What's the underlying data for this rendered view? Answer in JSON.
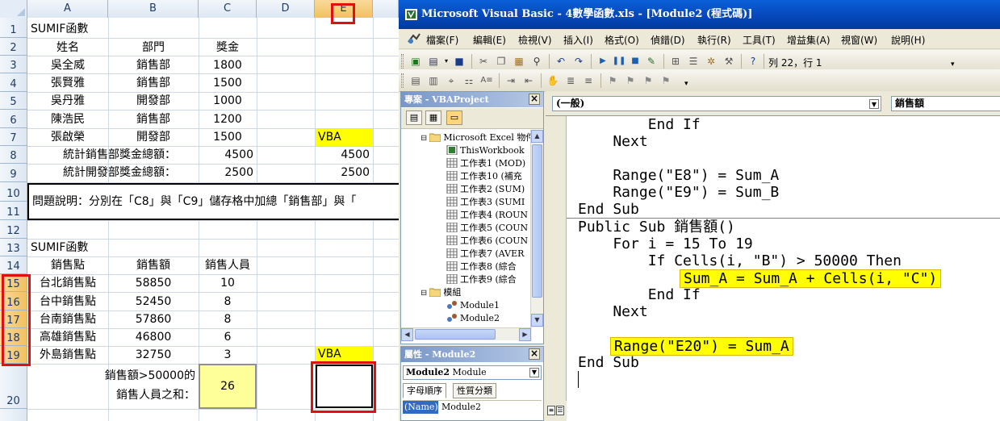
{
  "excel": {
    "columns": [
      "A",
      "B",
      "C",
      "D",
      "E"
    ],
    "selected_column": "E",
    "rows": [
      "1",
      "2",
      "3",
      "4",
      "5",
      "6",
      "7",
      "8",
      "9",
      "10",
      "11",
      "12",
      "13",
      "14",
      "15",
      "16",
      "17",
      "18",
      "19",
      "20"
    ],
    "table1": {
      "title": "SUMIF函數",
      "headers": [
        "姓名",
        "部門",
        "獎金"
      ],
      "rows": [
        [
          "吳全威",
          "銷售部",
          "1800"
        ],
        [
          "張賢雅",
          "銷售部",
          "1500"
        ],
        [
          "吳丹雅",
          "開發部",
          "1000"
        ],
        [
          "陳浩民",
          "銷售部",
          "1200"
        ],
        [
          "張啟榮",
          "開發部",
          "1500"
        ]
      ],
      "vba_label": "VBA",
      "sum_sales_label": "統計銷售部獎金總額：",
      "sum_sales_value": "4500",
      "sum_sales_vba": "4500",
      "sum_dev_label": "統計開發部獎金總額：",
      "sum_dev_value": "2500",
      "sum_dev_vba": "2500"
    },
    "question": "問題說明：分別在「C8」與「C9」儲存格中加總「銷售部」與「",
    "table2": {
      "title": "SUMIF函數",
      "headers": [
        "銷售點",
        "銷售額",
        "銷售人員"
      ],
      "rows": [
        [
          "台北銷售點",
          "58850",
          "10"
        ],
        [
          "台中銷售點",
          "52450",
          "8"
        ],
        [
          "台南銷售點",
          "57860",
          "8"
        ],
        [
          "高雄銷售點",
          "46800",
          "6"
        ],
        [
          "外島銷售點",
          "32750",
          "3"
        ]
      ],
      "vba_label": "VBA",
      "result_label_1": "銷售額>50000的",
      "result_label_2": "銷售人員之和：",
      "result_value": "26"
    }
  },
  "vbe": {
    "title": "Microsoft Visual Basic - 4數學函數.xls - [Module2 (程式碼)]",
    "menu": [
      "檔案(F)",
      "編輯(E)",
      "檢視(V)",
      "插入(I)",
      "格式(O)",
      "偵錯(D)",
      "執行(R)",
      "工具(T)",
      "增益集(A)",
      "視窗(W)",
      "說明(H)"
    ],
    "status_pos": "列 22，行 1",
    "project": {
      "title": "專案 - VBAProject",
      "group_excel": "Microsoft Excel 物件",
      "items": [
        "ThisWorkbook",
        "工作表1 (MOD)",
        "工作表10 (補充",
        "工作表2 (SUM)",
        "工作表3 (SUMI",
        "工作表4 (ROUN",
        "工作表5 (COUN",
        "工作表6 (COUN",
        "工作表7 (AVER",
        "工作表8 (綜合",
        "工作表9 (綜合"
      ],
      "group_modules": "模組",
      "modules": [
        "Module1",
        "Module2"
      ]
    },
    "properties": {
      "title": "屬性 - Module2",
      "object_name": "Module2",
      "object_type": "Module",
      "tab_alpha": "字母順序",
      "tab_category": "性質分類",
      "prop_key": "(Name)",
      "prop_value": "Module2"
    },
    "code": {
      "object_combo": "(一般)",
      "proc_combo": "銷售額",
      "lines_a": [
        "        End If",
        "    Next",
        "",
        "    Range(\"E8\") = Sum_A",
        "    Range(\"E9\") = Sum_B",
        "End Sub"
      ],
      "lines_b": [
        "Public Sub 銷售額()",
        "    For i = 15 To 19",
        "        If Cells(i, \"B\") > 50000 Then",
        "",
        "        End If",
        "    Next",
        "",
        "",
        "End Sub"
      ],
      "highlight_1": "Sum_A = Sum_A + Cells(i, \"C\")",
      "highlight_2": "Range(\"E20\") = Sum_A"
    }
  }
}
